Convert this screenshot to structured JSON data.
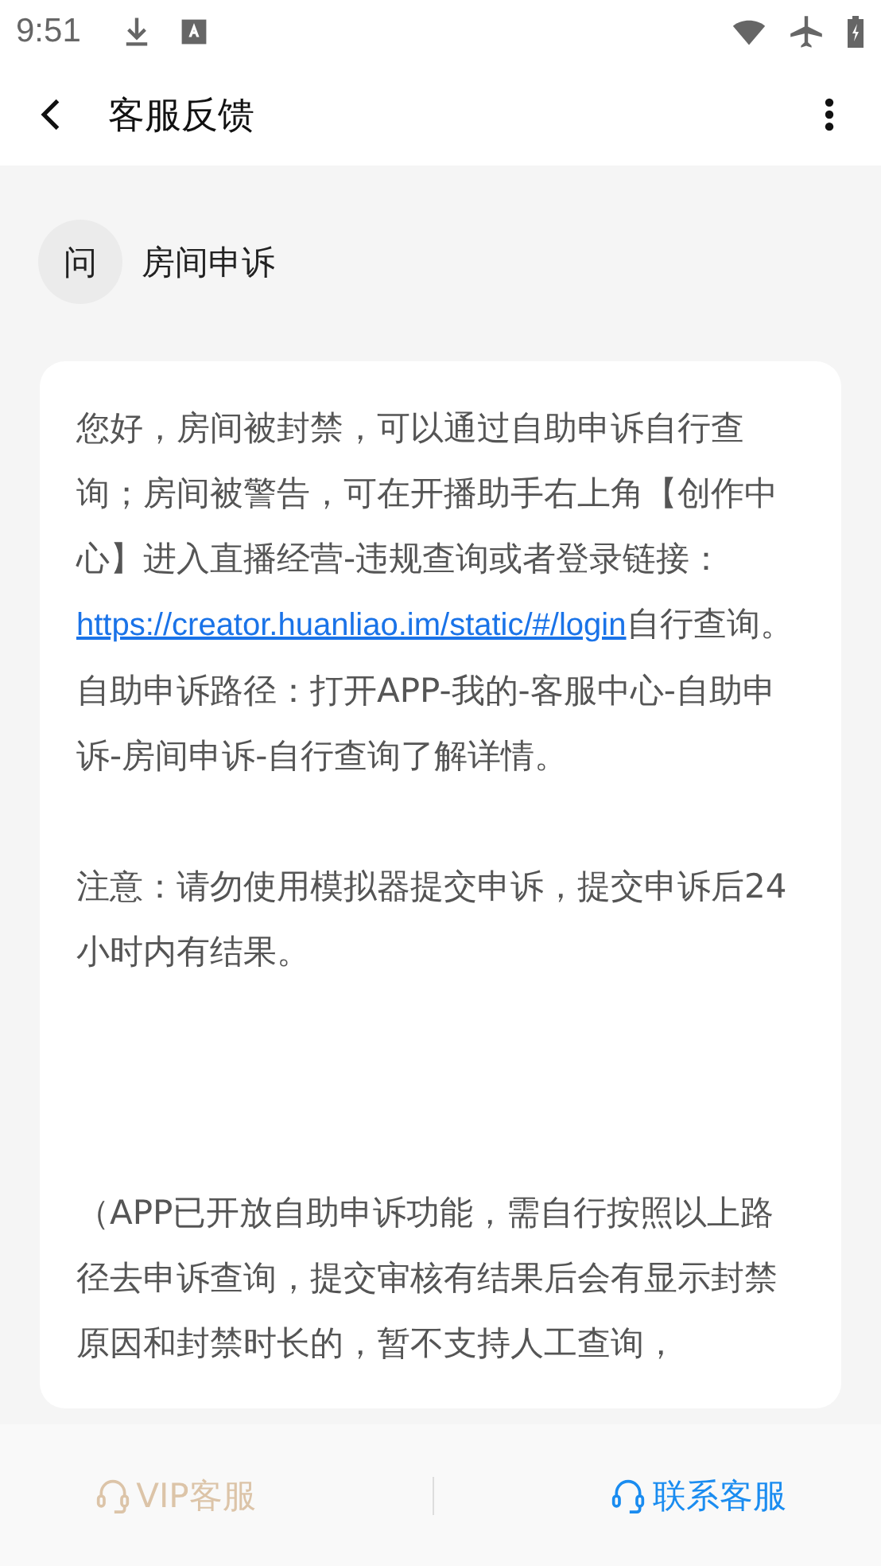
{
  "status_bar": {
    "time": "9:51"
  },
  "app_bar": {
    "title": "客服反馈"
  },
  "topic": {
    "avatar": "问",
    "title": "房间申诉"
  },
  "message": {
    "paragraphs": [
      {
        "parts": [
          {
            "kind": "text",
            "text": "您好，房间被封禁，可以通过自助申诉自行查询；房间被警告，可在开播助手右上角【创作中心】进入直播经营-违规查询或者登录链接："
          },
          {
            "kind": "link",
            "text": "https://creator.huanliao.im/static/#/login"
          },
          {
            "kind": "text",
            "text": "自行查询。"
          }
        ]
      },
      {
        "parts": [
          {
            "kind": "text",
            "text": "自助申诉路径：打开APP-我的-客服中心-自助申诉-房间申诉-自行查询了解详情。"
          }
        ]
      },
      {
        "parts": [
          {
            "kind": "text",
            "text": "注意：请勿使用模拟器提交申诉，提交申诉后24小时内有结果。"
          }
        ]
      },
      {
        "parts": [
          {
            "kind": "text",
            "text": "（APP已开放自助申诉功能，需自行按照以上路径去申诉查询，提交审核有结果后会有显示封禁原因和封禁时长的，暂不支持人工查询，"
          }
        ]
      }
    ]
  },
  "bottom_bar": {
    "buttons": [
      {
        "label": "VIP客服",
        "color": "#dcc4a8"
      },
      {
        "label": "联系客服",
        "color": "#1a8cf0"
      }
    ]
  }
}
